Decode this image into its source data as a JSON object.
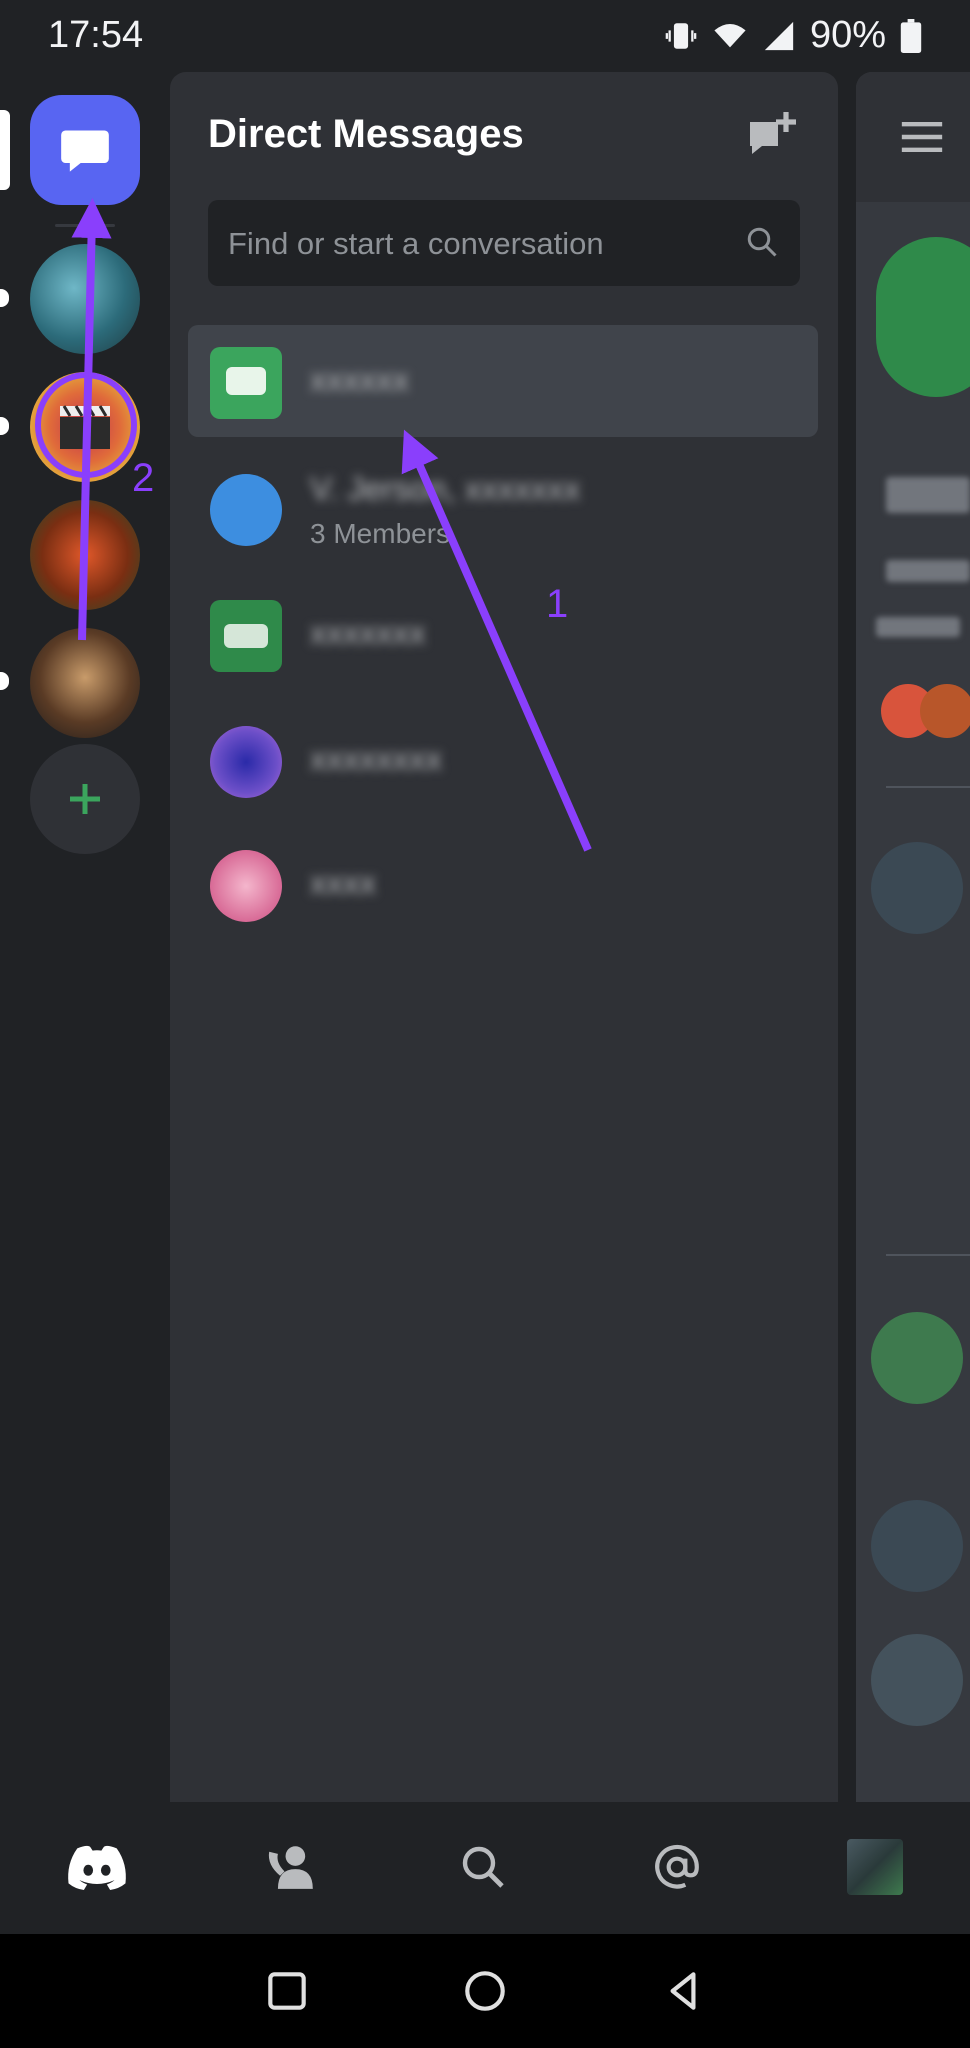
{
  "status_bar": {
    "time": "17:54",
    "battery": "90%"
  },
  "dm_panel": {
    "title": "Direct Messages",
    "search_placeholder": "Find or start a conversation",
    "conversations": [
      {
        "name": "xxxxxx",
        "sub": ""
      },
      {
        "name": "V. Jerson, xxxxxxx",
        "sub": "3 Members"
      },
      {
        "name": "xxxxxxx",
        "sub": ""
      },
      {
        "name": "xxxxxxxx",
        "sub": ""
      },
      {
        "name": "xxxx",
        "sub": ""
      }
    ]
  },
  "annotations": {
    "arrow_1_label": "1",
    "arrow_2_label": "2"
  },
  "colors": {
    "accent": "#5865f2",
    "annotation": "#8a3ffc",
    "add_green": "#3ba55d"
  },
  "icons": {
    "home": "chat-bubble-icon",
    "new_dm": "new-message-icon",
    "search": "search-icon",
    "menu": "hamburger-icon",
    "tabs": [
      "discord-logo-icon",
      "friends-icon",
      "search-icon",
      "mentions-icon",
      "avatar"
    ]
  }
}
